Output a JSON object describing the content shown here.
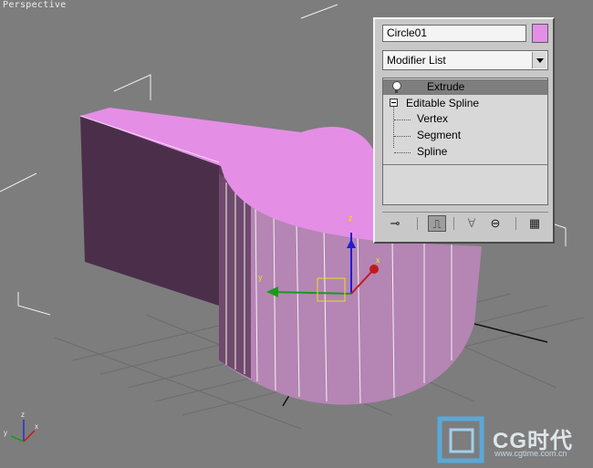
{
  "viewport": {
    "label": "Perspective",
    "gizmo_axis_labels": {
      "x": "x",
      "y": "y",
      "z": "z"
    },
    "corner_axis_labels": {
      "x": "x",
      "y": "y",
      "z": "z"
    },
    "object_color": "#e58ee6"
  },
  "modify_panel": {
    "object_name": "Circle01",
    "object_color": "#e58ee6",
    "modifier_list_label": "Modifier List",
    "stack": {
      "extrude": "Extrude",
      "editable_spline": "Editable Spline",
      "vertex": "Vertex",
      "segment": "Segment",
      "spline": "Spline"
    },
    "toolbar_icons": [
      "pin-stack-icon",
      "show-end-result-icon",
      "make-unique-icon",
      "remove-modifier-icon",
      "configure-sets-icon"
    ]
  },
  "watermark": {
    "text": "CG时代",
    "url": "www.cgtime.com.cn"
  }
}
